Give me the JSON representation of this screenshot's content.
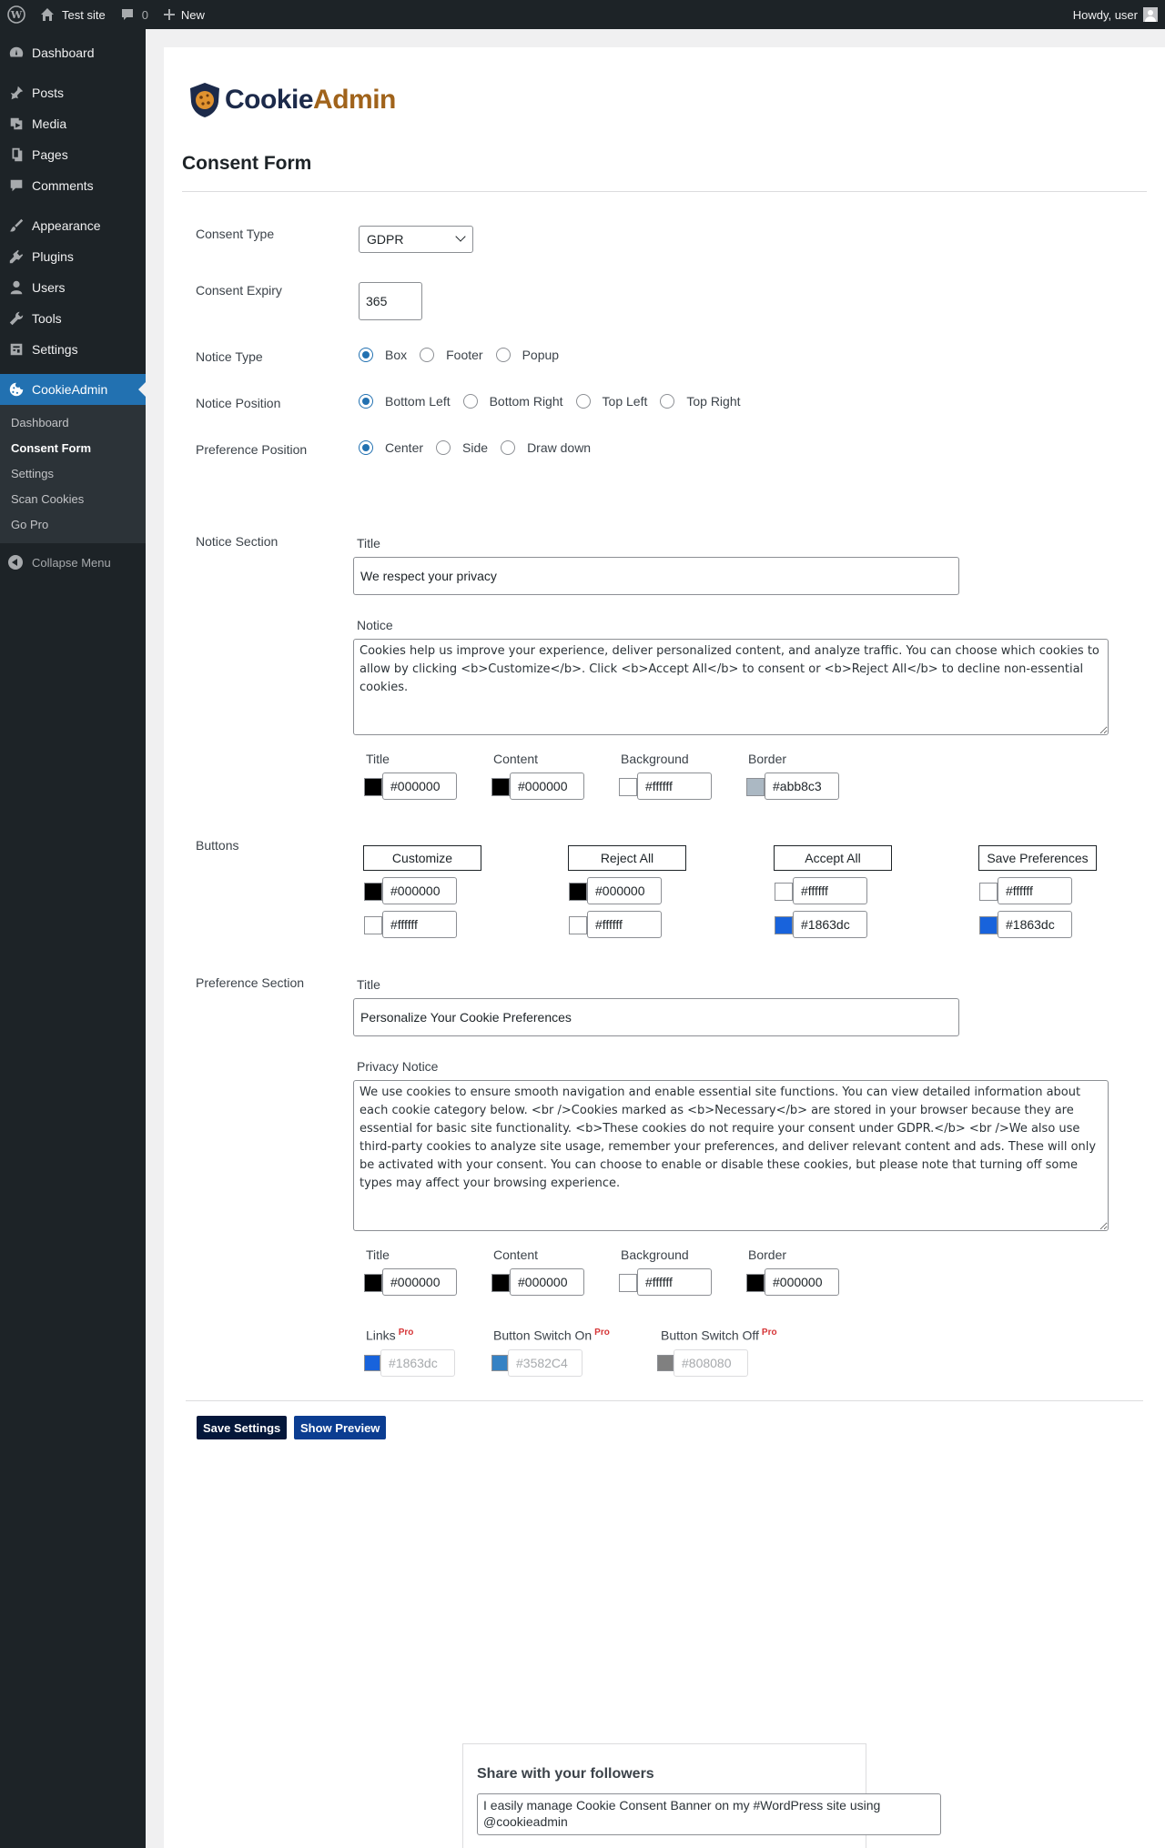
{
  "admin_bar": {
    "site_name": "Test site",
    "comments_count": "0",
    "new_label": "New",
    "howdy": "Howdy, user"
  },
  "sidebar": {
    "items": [
      {
        "label": "Dashboard",
        "icon": "dashboard-icon"
      },
      {
        "label": "Posts",
        "icon": "pin-icon"
      },
      {
        "label": "Media",
        "icon": "media-icon"
      },
      {
        "label": "Pages",
        "icon": "pages-icon"
      },
      {
        "label": "Comments",
        "icon": "comment-icon"
      },
      {
        "label": "Appearance",
        "icon": "brush-icon"
      },
      {
        "label": "Plugins",
        "icon": "plugin-icon"
      },
      {
        "label": "Users",
        "icon": "user-icon"
      },
      {
        "label": "Tools",
        "icon": "wrench-icon"
      },
      {
        "label": "Settings",
        "icon": "settings-icon"
      },
      {
        "label": "CookieAdmin",
        "icon": "cookie-icon"
      }
    ],
    "submenu": [
      "Dashboard",
      "Consent Form",
      "Settings",
      "Scan Cookies",
      "Go Pro"
    ],
    "collapse_label": "Collapse Menu"
  },
  "logo": {
    "part1": "Cookie",
    "part2": "Admin"
  },
  "page_title": "Consent Form",
  "form": {
    "consent_type": {
      "label": "Consent Type",
      "value": "GDPR"
    },
    "consent_expiry": {
      "label": "Consent Expiry",
      "value": "365"
    },
    "notice_type": {
      "label": "Notice Type",
      "options": [
        "Box",
        "Footer",
        "Popup"
      ],
      "selected": "Box"
    },
    "notice_position": {
      "label": "Notice Position",
      "options": [
        "Bottom Left",
        "Bottom Right",
        "Top Left",
        "Top Right"
      ],
      "selected": "Bottom Left"
    },
    "preference_position": {
      "label": "Preference Position",
      "options": [
        "Center",
        "Side",
        "Draw down"
      ],
      "selected": "Center"
    },
    "notice_section": {
      "label": "Notice Section",
      "title_label": "Title",
      "title_value": "We respect your privacy",
      "notice_label": "Notice",
      "notice_value": "Cookies help us improve your experience, deliver personalized content, and analyze traffic. You can choose which cookies to allow by clicking <b>Customize</b>. Click <b>Accept All</b> to consent or <b>Reject All</b> to decline non-essential cookies.",
      "colors": [
        {
          "label": "Title",
          "value": "#000000",
          "swatch": "#000000"
        },
        {
          "label": "Content",
          "value": "#000000",
          "swatch": "#000000"
        },
        {
          "label": "Background",
          "value": "#ffffff",
          "swatch": "#ffffff"
        },
        {
          "label": "Border",
          "value": "#abb8c3",
          "swatch": "#abb8c3"
        }
      ]
    },
    "buttons": {
      "label": "Buttons",
      "items": [
        {
          "label": "Customize",
          "color1": "#000000",
          "color2": "#ffffff"
        },
        {
          "label": "Reject All",
          "color1": "#000000",
          "color2": "#ffffff"
        },
        {
          "label": "Accept All",
          "color1": "#ffffff",
          "color2": "#1863dc"
        },
        {
          "label": "Save Preferences",
          "color1": "#ffffff",
          "color2": "#1863dc"
        }
      ]
    },
    "preference_section": {
      "label": "Preference Section",
      "title_label": "Title",
      "title_value": "Personalize Your Cookie Preferences",
      "notice_label": "Privacy Notice",
      "notice_value": "We use cookies to ensure smooth navigation and enable essential site functions. You can view detailed information about each cookie category below. <br />Cookies marked as <b>Necessary</b> are stored in your browser because they are essential for basic site functionality. <b>These cookies do not require your consent under GDPR.</b> <br />We also use third-party cookies to analyze site usage, remember your preferences, and deliver relevant content and ads. These will only be activated with your consent. You can choose to enable or disable these cookies, but please note that turning off some types may affect your browsing experience.",
      "colors": [
        {
          "label": "Title",
          "value": "#000000",
          "swatch": "#000000"
        },
        {
          "label": "Content",
          "value": "#000000",
          "swatch": "#000000"
        },
        {
          "label": "Background",
          "value": "#ffffff",
          "swatch": "#ffffff"
        },
        {
          "label": "Border",
          "value": "#000000",
          "swatch": "#000000"
        }
      ],
      "pro_badge": "Pro",
      "pro_colors": [
        {
          "label": "Links",
          "value": "#1863dc",
          "swatch": "#1863dc"
        },
        {
          "label": "Button Switch On",
          "value": "#3582C4",
          "swatch": "#3582C4"
        },
        {
          "label": "Button Switch Off",
          "value": "#808080",
          "swatch": "#808080"
        }
      ]
    }
  },
  "actions": {
    "save": "Save Settings",
    "preview": "Show Preview"
  },
  "share": {
    "title": "Share with your followers",
    "text": "I easily manage Cookie Consent Banner on my #WordPress site using @cookieadmin"
  }
}
